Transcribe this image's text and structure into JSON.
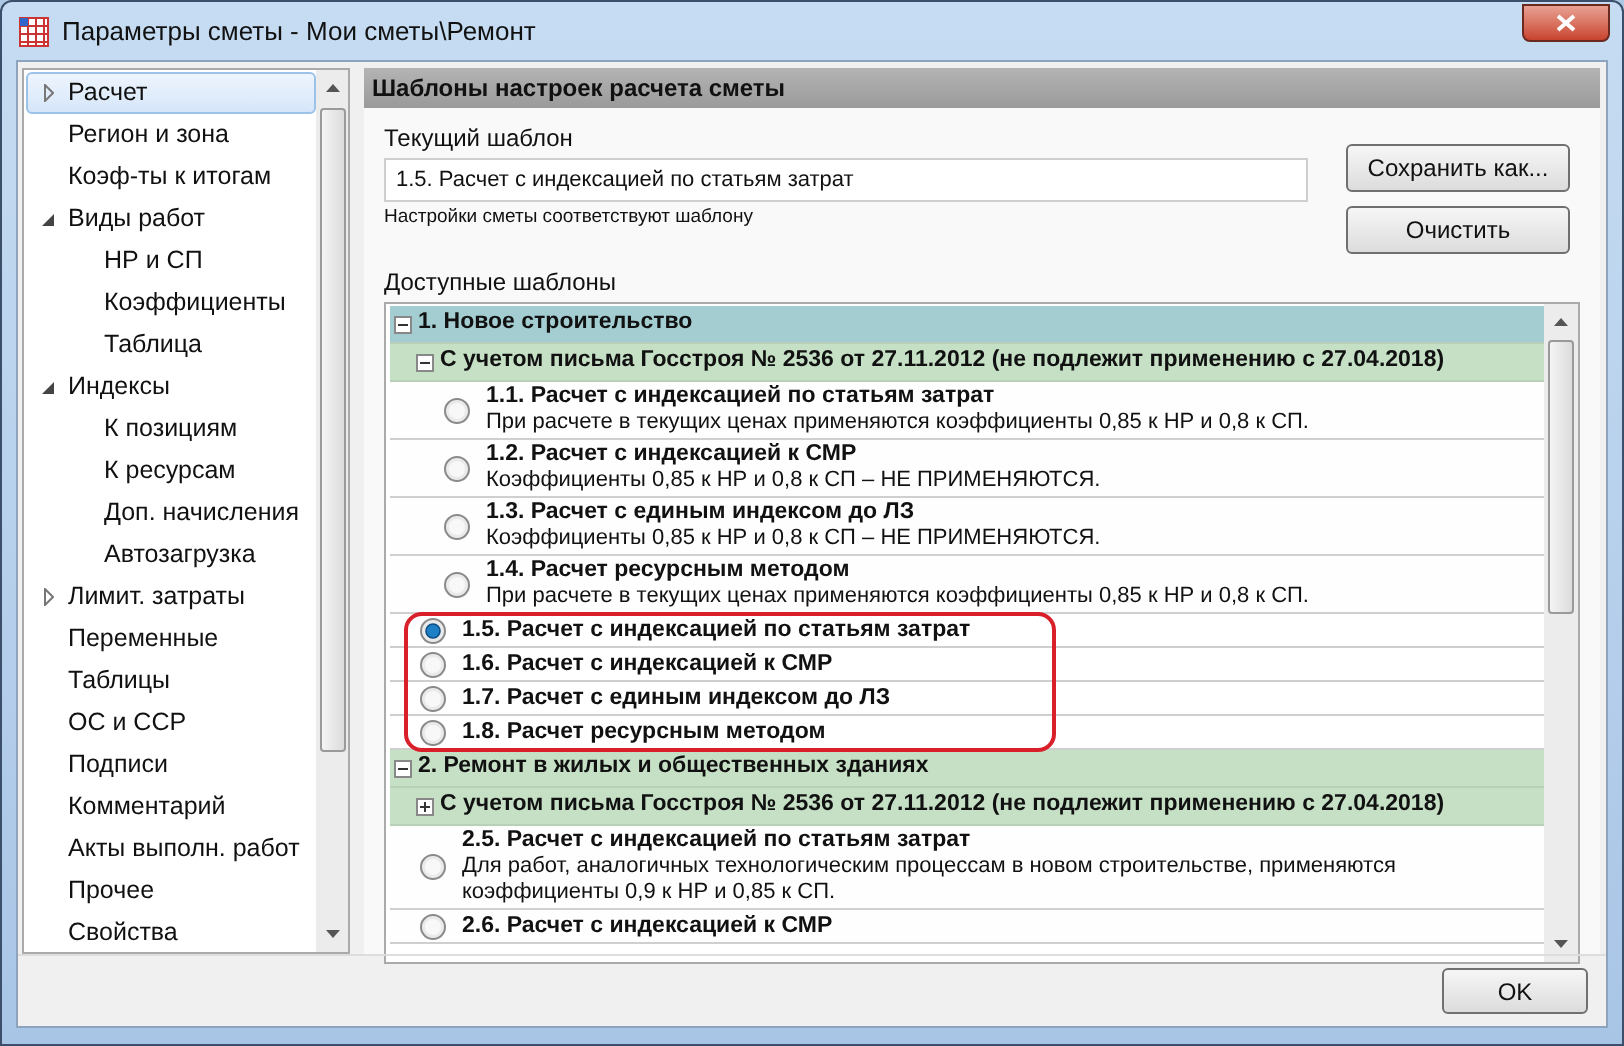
{
  "window": {
    "title": "Параметры сметы - Мои сметы\\Ремонт"
  },
  "sidebar": {
    "items": [
      {
        "label": "Расчет",
        "selected": true,
        "expanded": false
      },
      {
        "label": "Регион и зона",
        "selected": false
      },
      {
        "label": "Коэф-ты к итогам",
        "selected": false
      },
      {
        "label": "Виды работ",
        "selected": false,
        "expanded": true,
        "children": [
          {
            "label": "НР и СП",
            "selected": false
          },
          {
            "label": "Коэффициенты",
            "selected": false
          },
          {
            "label": "Таблица",
            "selected": false
          }
        ]
      },
      {
        "label": "Индексы",
        "selected": false,
        "expanded": true,
        "children": [
          {
            "label": "К позициям",
            "selected": false
          },
          {
            "label": "К ресурсам",
            "selected": false
          },
          {
            "label": "Доп. начисления",
            "selected": false
          },
          {
            "label": "Автозагрузка",
            "selected": false
          }
        ]
      },
      {
        "label": "Лимит. затраты",
        "selected": false,
        "expanded": false
      },
      {
        "label": "Переменные",
        "selected": false
      },
      {
        "label": "Таблицы",
        "selected": false
      },
      {
        "label": "ОС и ССР",
        "selected": false
      },
      {
        "label": "Подписи",
        "selected": false
      },
      {
        "label": "Комментарий",
        "selected": false
      },
      {
        "label": "Акты выполн. работ",
        "selected": false
      },
      {
        "label": "Прочее",
        "selected": false
      },
      {
        "label": "Свойства",
        "selected": false
      }
    ]
  },
  "panel": {
    "title": "Шаблоны настроек расчета сметы",
    "current_template": {
      "label": "Текущий шаблон",
      "value": "1.5. Расчет с индексацией по статьям затрат",
      "note": "Настройки сметы соответствуют шаблону"
    },
    "buttons": [
      {
        "label": "Сохранить как..."
      },
      {
        "label": "Очистить"
      }
    ],
    "templates": {
      "label": "Доступные шаблоны",
      "groups": [
        {
          "title": "1. Новое строительство",
          "selected": true,
          "expanded": true,
          "children": [
            {
              "kind": "subgroup",
              "title": "С учетом письма Госстроя № 2536 от 27.11.2012 (не подлежит применению с 27.04.2018)",
              "expanded": true,
              "children": [
                {
                  "kind": "option",
                  "title": "1.1. Расчет с индексацией по статьям затрат",
                  "description": "При расчете в текущих ценах применяются коэффициенты 0,85 к НР и 0,8 к СП.",
                  "selected": false,
                  "framed": false
                },
                {
                  "kind": "option",
                  "title": "1.2. Расчет с индексацией к СМР",
                  "description": "Коэффициенты 0,85 к НР и 0,8 к СП – НЕ ПРИМЕНЯЮТСЯ.",
                  "selected": false,
                  "framed": false
                },
                {
                  "kind": "option",
                  "title": "1.3. Расчет с единым индексом до ЛЗ",
                  "description": "Коэффициенты 0,85 к НР и 0,8 к СП – НЕ ПРИМЕНЯЮТСЯ.",
                  "selected": false,
                  "framed": false
                },
                {
                  "kind": "option",
                  "title": "1.4. Расчет ресурсным методом",
                  "description": "При расчете в текущих ценах применяются коэффициенты 0,85 к НР и 0,8 к СП.",
                  "selected": false,
                  "framed": false
                }
              ]
            },
            {
              "kind": "option",
              "title": "1.5. Расчет с индексацией по статьям затрат",
              "selected": true,
              "framed": true
            },
            {
              "kind": "option",
              "title": "1.6. Расчет с индексацией к СМР",
              "selected": false,
              "framed": true
            },
            {
              "kind": "option",
              "title": "1.7. Расчет с единым индексом до ЛЗ",
              "selected": false,
              "framed": true
            },
            {
              "kind": "option",
              "title": "1.8. Расчет ресурсным методом",
              "selected": false,
              "framed": true
            }
          ]
        },
        {
          "title": "2. Ремонт в жилых и общественных зданиях",
          "selected": false,
          "expanded": true,
          "children": [
            {
              "kind": "subgroup",
              "title": "С учетом письма Госстроя № 2536 от 27.11.2012 (не подлежит применению с 27.04.2018)",
              "expanded": false
            },
            {
              "kind": "option",
              "title": "2.5. Расчет с индексацией по статьям затрат",
              "description": "Для работ, аналогичных технологическим процессам в новом строительстве, применяются коэффициенты 0,9 к НР и 0,85 к СП.",
              "selected": false,
              "framed": false
            },
            {
              "kind": "option",
              "title": "2.6. Расчет с индексацией к СМР",
              "selected": false,
              "framed": false
            }
          ]
        }
      ]
    }
  },
  "footer": {
    "ok_button": "OK"
  }
}
